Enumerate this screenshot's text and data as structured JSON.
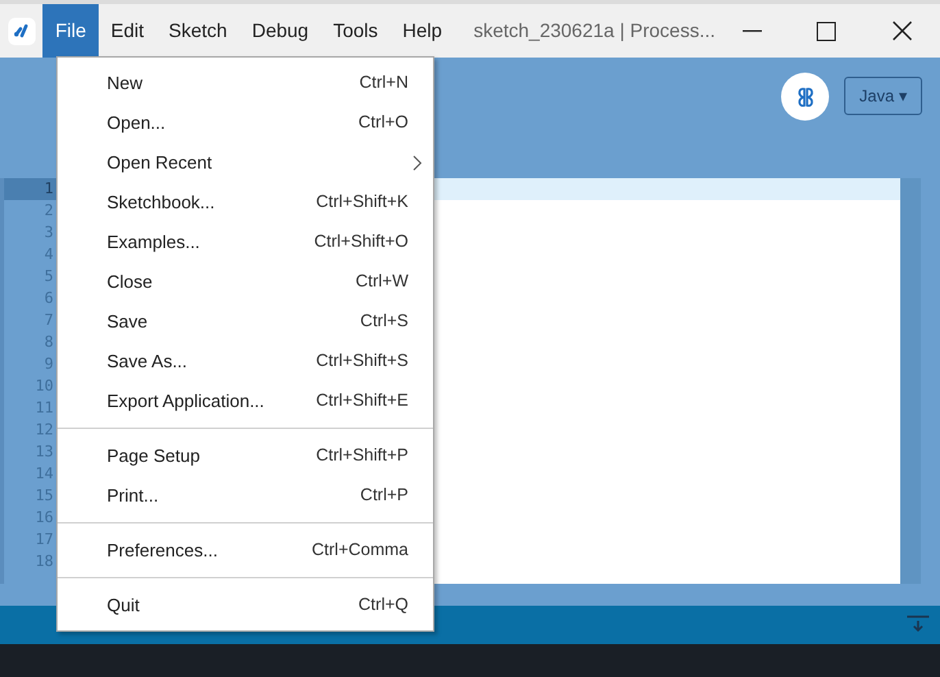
{
  "window": {
    "title": "sketch_230621a | Process..."
  },
  "menubar": [
    {
      "label": "File",
      "selected": true
    },
    {
      "label": "Edit",
      "selected": false
    },
    {
      "label": "Sketch",
      "selected": false
    },
    {
      "label": "Debug",
      "selected": false
    },
    {
      "label": "Tools",
      "selected": false
    },
    {
      "label": "Help",
      "selected": false
    }
  ],
  "mode_button": {
    "label": "Java ▾"
  },
  "file_menu": [
    {
      "kind": "item",
      "label": "New",
      "shortcut": "Ctrl+N"
    },
    {
      "kind": "item",
      "label": "Open...",
      "shortcut": "Ctrl+O"
    },
    {
      "kind": "submenu",
      "label": "Open Recent"
    },
    {
      "kind": "item",
      "label": "Sketchbook...",
      "shortcut": "Ctrl+Shift+K"
    },
    {
      "kind": "item",
      "label": "Examples...",
      "shortcut": "Ctrl+Shift+O"
    },
    {
      "kind": "item",
      "label": "Close",
      "shortcut": "Ctrl+W"
    },
    {
      "kind": "item",
      "label": "Save",
      "shortcut": "Ctrl+S"
    },
    {
      "kind": "item",
      "label": "Save As...",
      "shortcut": "Ctrl+Shift+S"
    },
    {
      "kind": "item",
      "label": "Export Application...",
      "shortcut": "Ctrl+Shift+E"
    },
    {
      "kind": "separator"
    },
    {
      "kind": "item",
      "label": "Page Setup",
      "shortcut": "Ctrl+Shift+P"
    },
    {
      "kind": "item",
      "label": "Print...",
      "shortcut": "Ctrl+P"
    },
    {
      "kind": "separator"
    },
    {
      "kind": "item",
      "label": "Preferences...",
      "shortcut": "Ctrl+Comma"
    },
    {
      "kind": "separator"
    },
    {
      "kind": "item",
      "label": "Quit",
      "shortcut": "Ctrl+Q"
    }
  ],
  "editor": {
    "line_numbers": [
      {
        "n": "1",
        "selected": true
      },
      {
        "n": "2",
        "selected": false
      },
      {
        "n": "3",
        "selected": false
      },
      {
        "n": "4",
        "selected": false
      },
      {
        "n": "5",
        "selected": false
      },
      {
        "n": "6",
        "selected": false
      },
      {
        "n": "7",
        "selected": false
      },
      {
        "n": "8",
        "selected": false
      },
      {
        "n": "9",
        "selected": false
      },
      {
        "n": "10",
        "selected": false
      },
      {
        "n": "11",
        "selected": false
      },
      {
        "n": "12",
        "selected": false
      },
      {
        "n": "13",
        "selected": false
      },
      {
        "n": "14",
        "selected": false
      },
      {
        "n": "15",
        "selected": false
      },
      {
        "n": "16",
        "selected": false
      },
      {
        "n": "17",
        "selected": false
      },
      {
        "n": "18",
        "selected": false
      }
    ]
  }
}
